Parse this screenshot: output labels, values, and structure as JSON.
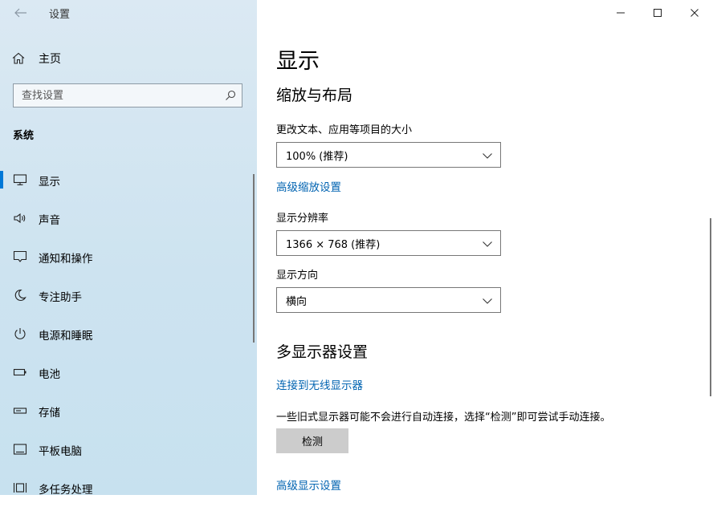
{
  "window": {
    "title": "设置"
  },
  "sidebar": {
    "home_label": "主页",
    "search_placeholder": "查找设置",
    "section_title": "系统",
    "items": [
      {
        "label": "显示",
        "icon": "monitor-icon",
        "selected": true
      },
      {
        "label": "声音",
        "icon": "speaker-icon"
      },
      {
        "label": "通知和操作",
        "icon": "notification-icon"
      },
      {
        "label": "专注助手",
        "icon": "moon-icon"
      },
      {
        "label": "电源和睡眠",
        "icon": "power-icon"
      },
      {
        "label": "电池",
        "icon": "battery-icon"
      },
      {
        "label": "存储",
        "icon": "storage-icon"
      },
      {
        "label": "平板电脑",
        "icon": "tablet-icon"
      },
      {
        "label": "多任务处理",
        "icon": "multitask-icon"
      }
    ]
  },
  "main": {
    "page_title": "显示",
    "scale_section_title": "缩放与布局",
    "scale_label": "更改文本、应用等项目的大小",
    "scale_value": "100% (推荐)",
    "advanced_scale_link": "高级缩放设置",
    "resolution_label": "显示分辨率",
    "resolution_value": "1366 × 768 (推荐)",
    "orientation_label": "显示方向",
    "orientation_value": "横向",
    "multi_display_title": "多显示器设置",
    "wireless_link": "连接到无线显示器",
    "detect_desc": "一些旧式显示器可能不会进行自动连接，选择“检测”即可尝试手动连接。",
    "detect_button": "检测",
    "advanced_display_link": "高级显示设置"
  },
  "colors": {
    "accent": "#0078d7",
    "link": "#0063b1",
    "sidebar_bg": "#cfe3f0"
  }
}
